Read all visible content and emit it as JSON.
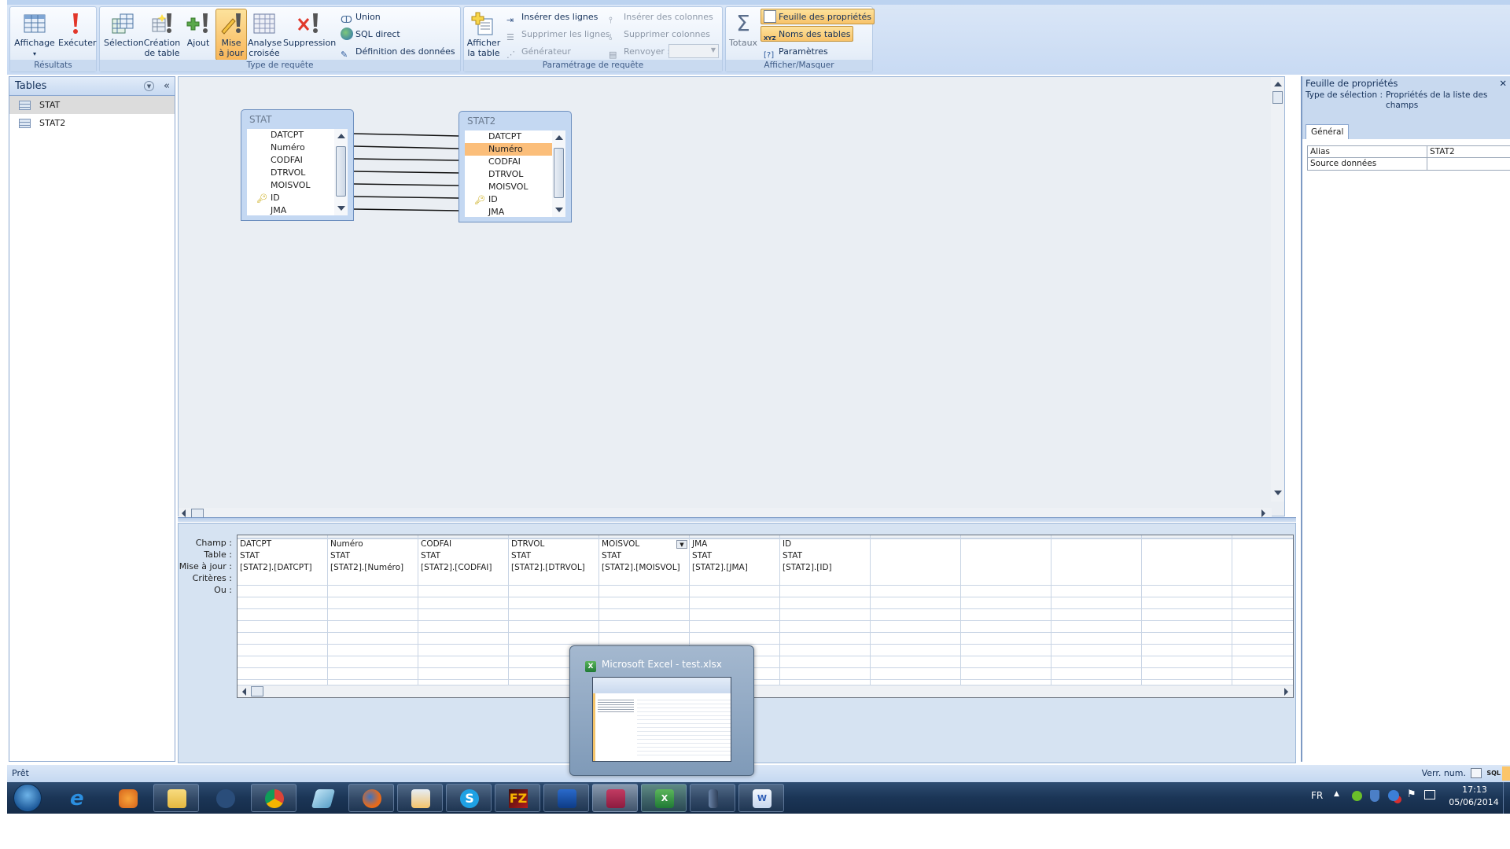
{
  "ribbon": {
    "resultats": {
      "label": "Résultats",
      "affichage": "Affichage",
      "executer": "Exécuter"
    },
    "type_requete": {
      "label": "Type de requête",
      "selection": "Sélection",
      "creation_l1": "Création",
      "creation_l2": "de table",
      "ajout": "Ajout",
      "mise_l1": "Mise",
      "mise_l2": "à jour",
      "analyse_l1": "Analyse",
      "analyse_l2": "croisée",
      "suppression": "Suppression",
      "union": "Union",
      "sql_direct": "SQL direct",
      "definition": "Définition des données"
    },
    "parametrage": {
      "label": "Paramétrage de requête",
      "afficher_l1": "Afficher",
      "afficher_l2": "la table",
      "inserer_lignes": "Insérer des lignes",
      "supprimer_lignes": "Supprimer les lignes",
      "generateur": "Générateur",
      "inserer_colonnes": "Insérer des colonnes",
      "supprimer_colonnes": "Supprimer colonnes",
      "renvoyer": "Renvoyer :",
      "renvoyer_value": ""
    },
    "afficher_masquer": {
      "label": "Afficher/Masquer",
      "totaux": "Totaux",
      "feuille": "Feuille des propriétés",
      "noms_tables": "Noms des tables",
      "parametres": "Paramètres"
    }
  },
  "nav": {
    "title": "Tables",
    "items": [
      {
        "label": "STAT"
      },
      {
        "label": "STAT2"
      }
    ]
  },
  "design": {
    "tables": [
      {
        "name": "STAT",
        "fields": [
          "DATCPT",
          "Numéro",
          "CODFAI",
          "DTRVOL",
          "MOISVOL",
          "ID",
          "JMA"
        ],
        "key_field": "ID"
      },
      {
        "name": "STAT2",
        "fields": [
          "DATCPT",
          "Numéro",
          "CODFAI",
          "DTRVOL",
          "MOISVOL",
          "ID",
          "JMA"
        ],
        "key_field": "ID",
        "selected_field": "Numéro"
      }
    ]
  },
  "grid": {
    "row_labels": [
      "Champ :",
      "Table :",
      "Mise à jour :",
      "Critères :",
      "Ou :"
    ],
    "columns": [
      {
        "champ": "DATCPT",
        "table": "STAT",
        "maj": "[STAT2].[DATCPT]"
      },
      {
        "champ": "Numéro",
        "table": "STAT",
        "maj": "[STAT2].[Numéro]"
      },
      {
        "champ": "CODFAI",
        "table": "STAT",
        "maj": "[STAT2].[CODFAI]"
      },
      {
        "champ": "DTRVOL",
        "table": "STAT",
        "maj": "[STAT2].[DTRVOL]"
      },
      {
        "champ": "MOISVOL",
        "table": "STAT",
        "maj": "[STAT2].[MOISVOL]"
      },
      {
        "champ": "JMA",
        "table": "STAT",
        "maj": "[STAT2].[JMA]"
      },
      {
        "champ": "ID",
        "table": "STAT",
        "maj": "[STAT2].[ID]"
      }
    ]
  },
  "props": {
    "title": "Feuille de propriétés",
    "selection_label": "Type de sélection :",
    "selection_value": "Propriétés de la liste des champs",
    "tab": "Général",
    "rows": [
      {
        "name": "Alias",
        "value": "STAT2"
      },
      {
        "name": "Source données",
        "value": ""
      }
    ]
  },
  "status": {
    "left": "Prêt",
    "right": "Verr. num.",
    "view_sql": "SQL"
  },
  "thumbnail": {
    "title": "Microsoft Excel - test.xlsx"
  },
  "taskbar": {
    "apps": [
      "start",
      "internet-explorer",
      "media-player",
      "explorer",
      "hp-support",
      "chrome",
      "notepad",
      "firefox",
      "windows-mail",
      "skype",
      "filezilla",
      "remote-desktop",
      "access",
      "excel",
      "server",
      "word"
    ],
    "lang": "FR",
    "time": "17:13",
    "date": "05/06/2014"
  }
}
